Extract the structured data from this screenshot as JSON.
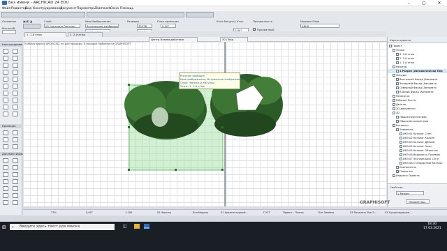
{
  "window": {
    "title": "Без имени - ARCHICAD 24 EDU"
  },
  "menu": [
    "Файл",
    "Редактор",
    "Вид",
    "Конструирование",
    "Документ",
    "Параметры",
    "Teamwork",
    "Окно",
    "Помощь"
  ],
  "infobox": {
    "label_main": "Основные",
    "label_layer": "Слой:",
    "label_pen": "Масштаб:",
    "layer_value": "00 Чертеж и Рисунки",
    "label_image": "Имя Изображения",
    "image_value": "Встроенное изображение",
    "size_value": "1100x1000 пиксел",
    "label_dims": "Размеры",
    "dim_w": "35278",
    "dim_h": "30000",
    "label_pos": "План проекции",
    "pos_val": "0,00°",
    "label_angle": "Угол Фигуры / Угол",
    "angle_value": "0,00°",
    "label_transparency": "Прозрачность",
    "transparency_value": "Прозрачный",
    "label_layer_right": "Ширина Пера",
    "label_scale": "Масштаб",
    "scale_value": "1:100",
    "layer_right_value": "ARHIL"
  },
  "tabs": [
    {
      "label": "1. 1-й этаж"
    },
    {
      "label": "2. 2-й этаж"
    }
  ],
  "canvas": {
    "notice": "Учебная версия ARCHICAD, не для продажи. В порядке любезности GRAPHISOFT.",
    "tooltip_lines": [
      "Рисунок (выбран)",
      "Имя изображения: Встроенное изображение",
      "Слой: Чертеж и Рисунки",
      "Этаж: 1. 1-й этаж"
    ],
    "tab2_label": "Центр Взаимодействия",
    "tab3_label": "30 / Вид"
  },
  "leftpanel": {
    "section1": "Конструирование",
    "section2": "Проекция",
    "section3": "Документирование"
  },
  "navigator": {
    "header": "Карты проекта",
    "items": [
      {
        "label": "Проект",
        "indent": 0
      },
      {
        "label": "Этажи",
        "indent": 1
      },
      {
        "label": "3. 3-й этаж",
        "indent": 2
      },
      {
        "label": "2. 2-й этаж",
        "indent": 2
      },
      {
        "label": "1. 1-й этаж",
        "indent": 2
      },
      {
        "label": "Разрезы",
        "indent": 1
      },
      {
        "label": "1 Разрез (Автоматически Пер",
        "indent": 2
      },
      {
        "label": "Фасады",
        "indent": 1
      },
      {
        "label": "Восточный Фасад (Автомати",
        "indent": 2
      },
      {
        "label": "Западный Фасад (Автомати",
        "indent": 2
      },
      {
        "label": "Северный Фасад (Автомати",
        "indent": 2
      },
      {
        "label": "Южный Фасад (Автомати",
        "indent": 2
      },
      {
        "label": "Развертки",
        "indent": 1
      },
      {
        "label": "Рабочие Листы",
        "indent": 1
      },
      {
        "label": "Детали",
        "indent": 1
      },
      {
        "label": "3D-документы",
        "indent": 1
      },
      {
        "label": "3D",
        "indent": 1
      },
      {
        "label": "Общая Перспектива",
        "indent": 2
      },
      {
        "label": "Общая Аксонометрия",
        "indent": 2
      },
      {
        "label": "Каталоги",
        "indent": 1
      },
      {
        "label": "Элементы",
        "indent": 2
      },
      {
        "label": "ИКЭ-01 Каталог Стен",
        "indent": 3
      },
      {
        "label": "ИКЭ-02 Каталог Колонн",
        "indent": 3
      },
      {
        "label": "ИКЭ-03 Каталог Дверей",
        "indent": 3
      },
      {
        "label": "ИКЭ-04 Каталог Окон",
        "indent": 3
      },
      {
        "label": "ИКЭ-05 Каталог Объектов",
        "indent": 3
      },
      {
        "label": "ИКЭ-06 Ведомость Проемов",
        "indent": 3
      },
      {
        "label": "ИКЭ-07 Экспликация 1-й эт",
        "indent": 3
      },
      {
        "label": "ИКЭ-08 Стандартный Каталог",
        "indent": 3
      },
      {
        "label": "Компоненты",
        "indent": 2
      },
      {
        "label": "Покрытия",
        "indent": 2
      },
      {
        "label": "Индексы Проекта",
        "indent": 1
      }
    ],
    "footer_label": "Свойства",
    "footer_value": "1 Разрез",
    "params_button": "Параметры..."
  },
  "bottombar": {
    "zoom": "27%",
    "angle": "0,00°",
    "scale": "1:100",
    "layer": "02 Чертеж",
    "model": "Вся Модель",
    "view": "01 Архитектурный...",
    "gost": "ГОСТ",
    "proj": "Проект - Плены",
    "no_override": "Без Замены",
    "show": "03 Показать Все Э...",
    "reno": "03 Существующее...",
    "brand": "GRAPHISOFT"
  },
  "taskbar": {
    "search_placeholder": "Введите здесь текст для поиска",
    "time": "18:30",
    "date": "17.03.2021"
  },
  "colors": {
    "selection": "#7fd47f",
    "accent": "#2f6db5"
  }
}
